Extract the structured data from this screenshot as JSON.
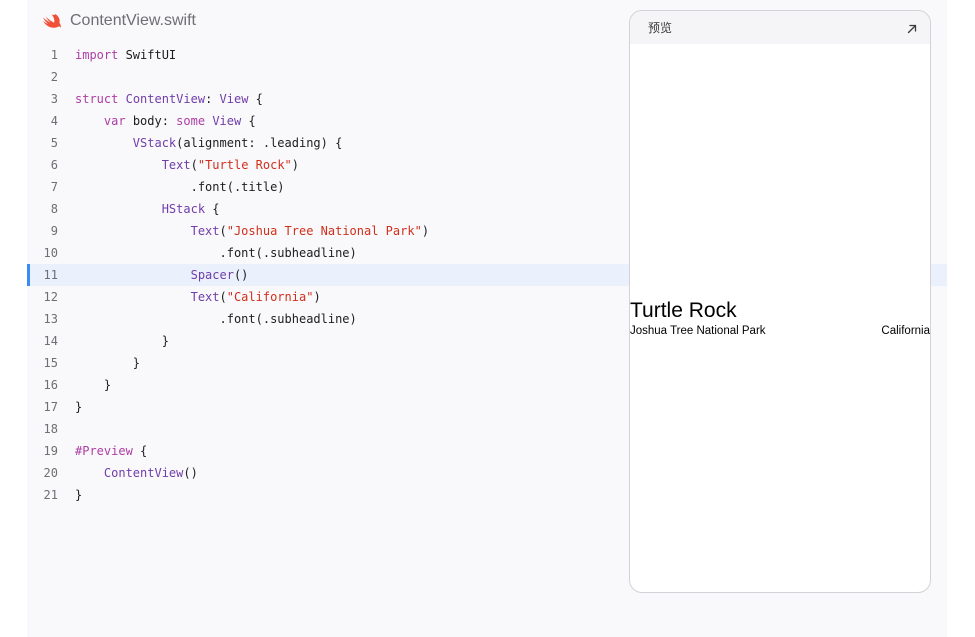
{
  "file": {
    "name": "ContentView.swift",
    "icon": "swift-logo-icon",
    "icon_color": "#f05138"
  },
  "code": {
    "highlighted_line": 11,
    "lines": [
      {
        "n": "1",
        "tokens": [
          {
            "t": "import",
            "c": "kw"
          },
          {
            "t": " SwiftUI"
          }
        ]
      },
      {
        "n": "2",
        "tokens": []
      },
      {
        "n": "3",
        "tokens": [
          {
            "t": "struct",
            "c": "kw"
          },
          {
            "t": " "
          },
          {
            "t": "ContentView",
            "c": "ty"
          },
          {
            "t": ": "
          },
          {
            "t": "View",
            "c": "ty"
          },
          {
            "t": " {"
          }
        ]
      },
      {
        "n": "4",
        "tokens": [
          {
            "t": "    "
          },
          {
            "t": "var",
            "c": "kw"
          },
          {
            "t": " body: "
          },
          {
            "t": "some",
            "c": "kw"
          },
          {
            "t": " "
          },
          {
            "t": "View",
            "c": "ty"
          },
          {
            "t": " {"
          }
        ]
      },
      {
        "n": "5",
        "tokens": [
          {
            "t": "        "
          },
          {
            "t": "VStack",
            "c": "ty"
          },
          {
            "t": "(alignment: .leading) {"
          }
        ]
      },
      {
        "n": "6",
        "tokens": [
          {
            "t": "            "
          },
          {
            "t": "Text",
            "c": "ty"
          },
          {
            "t": "("
          },
          {
            "t": "\"Turtle Rock\"",
            "c": "st"
          },
          {
            "t": ")"
          }
        ]
      },
      {
        "n": "7",
        "tokens": [
          {
            "t": "                .font(.title)"
          }
        ]
      },
      {
        "n": "8",
        "tokens": [
          {
            "t": "            "
          },
          {
            "t": "HStack",
            "c": "ty"
          },
          {
            "t": " {"
          }
        ]
      },
      {
        "n": "9",
        "tokens": [
          {
            "t": "                "
          },
          {
            "t": "Text",
            "c": "ty"
          },
          {
            "t": "("
          },
          {
            "t": "\"Joshua Tree National Park\"",
            "c": "st"
          },
          {
            "t": ")"
          }
        ]
      },
      {
        "n": "10",
        "tokens": [
          {
            "t": "                    .font(.subheadline)"
          }
        ]
      },
      {
        "n": "11",
        "tokens": [
          {
            "t": "                "
          },
          {
            "t": "Spacer",
            "c": "ty"
          },
          {
            "t": "()"
          }
        ]
      },
      {
        "n": "12",
        "tokens": [
          {
            "t": "                "
          },
          {
            "t": "Text",
            "c": "ty"
          },
          {
            "t": "("
          },
          {
            "t": "\"California\"",
            "c": "st"
          },
          {
            "t": ")"
          }
        ]
      },
      {
        "n": "13",
        "tokens": [
          {
            "t": "                    .font(.subheadline)"
          }
        ]
      },
      {
        "n": "14",
        "tokens": [
          {
            "t": "            }"
          }
        ]
      },
      {
        "n": "15",
        "tokens": [
          {
            "t": "        }"
          }
        ]
      },
      {
        "n": "16",
        "tokens": [
          {
            "t": "    }"
          }
        ]
      },
      {
        "n": "17",
        "tokens": [
          {
            "t": "}"
          }
        ]
      },
      {
        "n": "18",
        "tokens": []
      },
      {
        "n": "19",
        "tokens": [
          {
            "t": "#Preview",
            "c": "kw"
          },
          {
            "t": " {"
          }
        ]
      },
      {
        "n": "20",
        "tokens": [
          {
            "t": "    "
          },
          {
            "t": "ContentView",
            "c": "ty"
          },
          {
            "t": "()"
          }
        ]
      },
      {
        "n": "21",
        "tokens": [
          {
            "t": "}"
          }
        ]
      }
    ]
  },
  "preview": {
    "title": "预览",
    "expand_icon": "expand-arrow-icon",
    "content": {
      "title": "Turtle Rock",
      "subtitle": "Joshua Tree National Park",
      "location": "California"
    }
  },
  "colors": {
    "keyword": "#ad3da4",
    "type": "#703daa",
    "string": "#d12f1b",
    "highlight_bg": "#eaf1fc",
    "highlight_bar": "#3b8bf5"
  }
}
